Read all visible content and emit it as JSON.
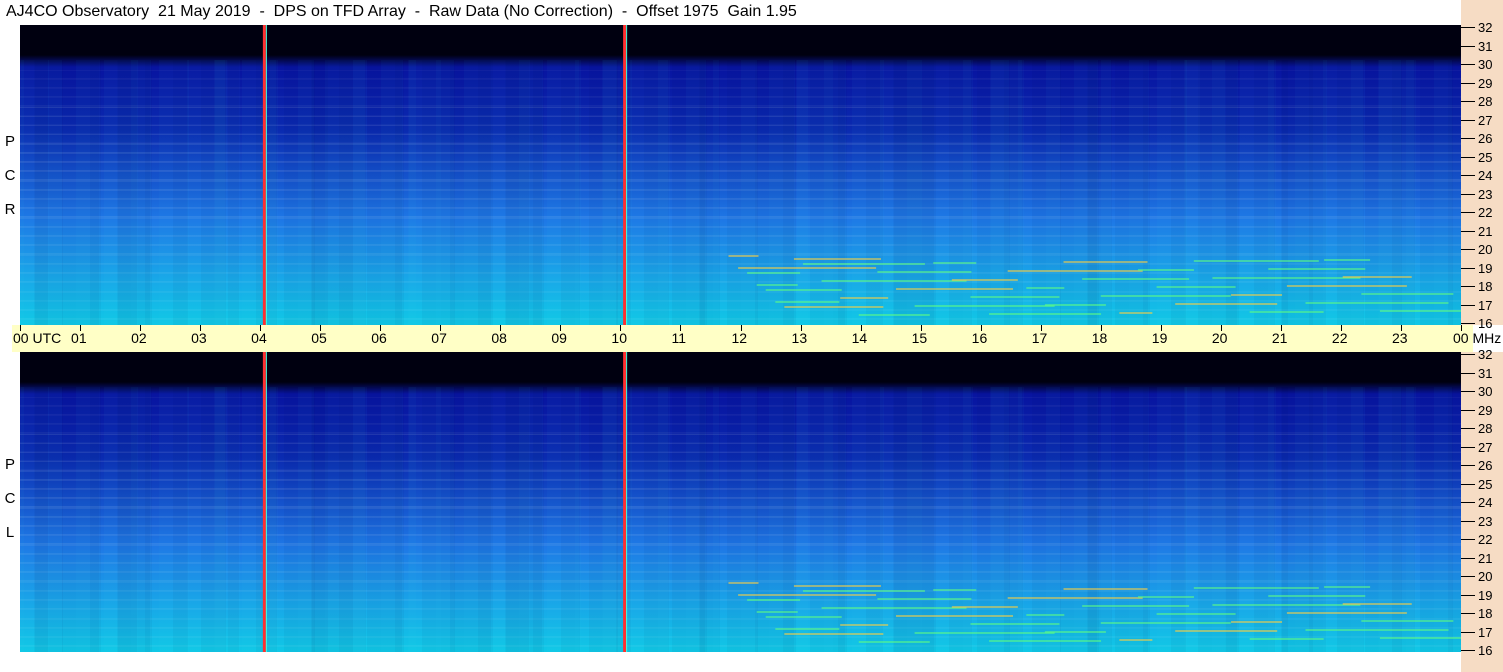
{
  "title": "AJ4CO Observatory  21 May 2019  -  DPS on TFD Array  -  Raw Data (No Correction)  -  Offset 1975  Gain 1.95",
  "panels": [
    {
      "label_letters": [
        "R",
        "C",
        "P"
      ]
    },
    {
      "label_letters": [
        "L",
        "C",
        "P"
      ]
    }
  ],
  "colors": {
    "background_dark": "#000010",
    "band_dark_blue": "#0a2ab0",
    "band_mid_blue": "#1e78e6",
    "band_cyan": "#10c8e6",
    "axis_strip": "#ffffc6",
    "y_axis_track": "#f6dcc4",
    "marker_line": "#ff3030"
  },
  "chart_data": {
    "type": "heatmap",
    "x_unit": "UTC",
    "y_unit": "MHz",
    "x_ticks": [
      "00",
      "01",
      "02",
      "03",
      "04",
      "05",
      "06",
      "07",
      "08",
      "09",
      "10",
      "11",
      "12",
      "13",
      "14",
      "15",
      "16",
      "17",
      "18",
      "19",
      "20",
      "21",
      "22",
      "23",
      "00"
    ],
    "x_first_label": "00  UTC",
    "x_last_label": "00 MHz",
    "xlim": [
      0,
      24
    ],
    "y_ticks": [
      "16",
      "17",
      "18",
      "19",
      "20",
      "21",
      "22",
      "23",
      "24",
      "25",
      "26",
      "27",
      "28",
      "29",
      "30",
      "31",
      "32"
    ],
    "ylim": [
      16,
      32
    ],
    "markers_utc": [
      4.07,
      10.07
    ],
    "series": [
      {
        "name": "RCP"
      },
      {
        "name": "LCP"
      }
    ]
  }
}
